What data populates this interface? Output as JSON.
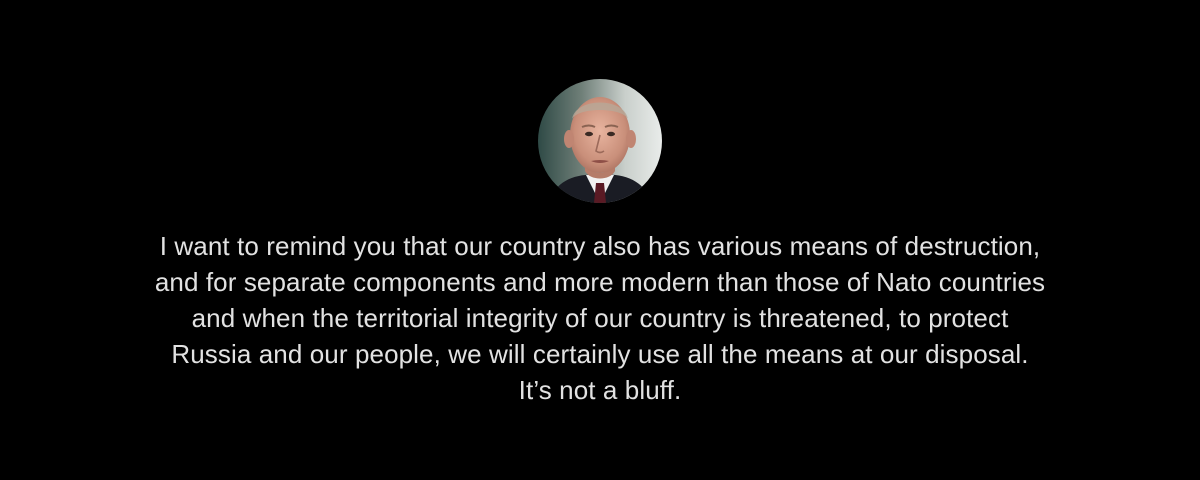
{
  "quote": {
    "lines": [
      "I want to remind you that our country also has various means of destruction,",
      "and for separate components and more modern than those of Nato countries",
      "and when the territorial integrity of our country is threatened, to protect",
      "Russia and our people, we will certainly use all the means at our disposal.",
      "It’s not a bluff."
    ]
  },
  "colors": {
    "background": "#000000",
    "text": "#e2e2e2"
  }
}
